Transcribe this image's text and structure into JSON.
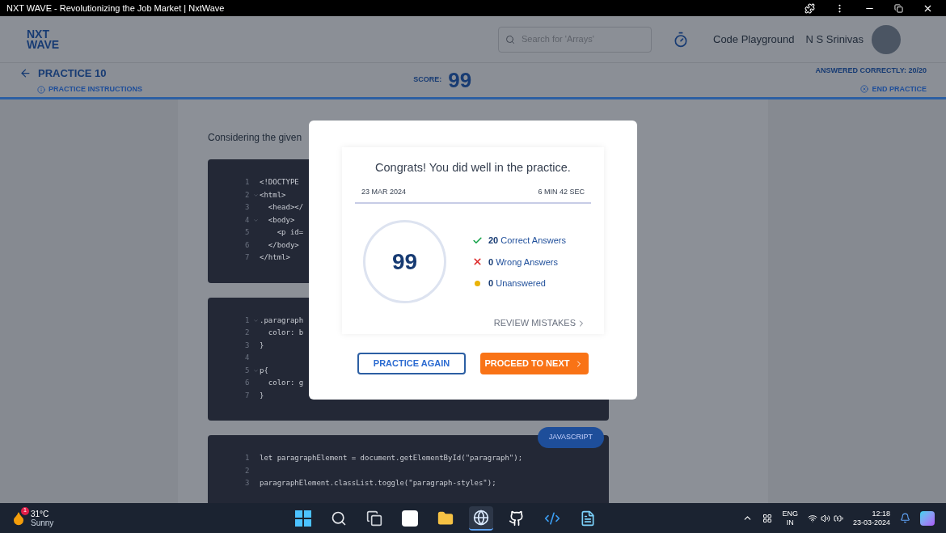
{
  "window": {
    "title": "NXT WAVE - Revolutionizing the Job Market | NxtWave"
  },
  "header": {
    "logo": [
      "NXT",
      "WAVE"
    ],
    "search": {
      "placeholder": "Search for 'Arrays'"
    },
    "link": "Code Playground",
    "user_name": "N S Srinivas"
  },
  "practice_bar": {
    "title": "PRACTICE 10",
    "instructions": "PRACTICE INSTRUCTIONS",
    "score_label": "SCORE:",
    "score": "99",
    "answered": "ANSWERED CORRECTLY: 20/20",
    "end": "END PRACTICE"
  },
  "question": {
    "text": "Considering the given"
  },
  "code_blocks": [
    {
      "lines": [
        {
          "number": "1",
          "fold": false,
          "code": "<!DOCTYPE"
        },
        {
          "number": "2",
          "fold": true,
          "code": "<html>"
        },
        {
          "number": "3",
          "fold": false,
          "code": "  <head></"
        },
        {
          "number": "4",
          "fold": true,
          "code": "  <body>"
        },
        {
          "number": "5",
          "fold": false,
          "code": "    <p id="
        },
        {
          "number": "6",
          "fold": false,
          "code": "  </body>"
        },
        {
          "number": "7",
          "fold": false,
          "code": "</html>"
        }
      ]
    },
    {
      "lines": [
        {
          "number": "1",
          "fold": true,
          "code": ".paragraph"
        },
        {
          "number": "2",
          "fold": false,
          "code": "  color: b"
        },
        {
          "number": "3",
          "fold": false,
          "code": "}"
        },
        {
          "number": "4",
          "fold": false
        },
        {
          "number": "5",
          "fold": true,
          "code": "p{"
        },
        {
          "number": "6",
          "fold": false,
          "code": "  color: g"
        },
        {
          "number": "7",
          "fold": false,
          "code": "}"
        }
      ]
    },
    {
      "language": "JAVASCRIPT",
      "lines": [
        {
          "number": "1",
          "fold": false,
          "code": "let paragraphElement = document.getElementById(\"paragraph\");"
        },
        {
          "number": "2",
          "fold": false
        },
        {
          "number": "3",
          "fold": false,
          "code": "paragraphElement.classList.toggle(\"paragraph-styles\");"
        }
      ]
    }
  ],
  "dialog": {
    "title": "Congrats! You did well in the practice.",
    "date": "23 MAR 2024",
    "duration": "6 MIN 42 SEC",
    "score": "99",
    "stats": [
      {
        "kind": "correct",
        "count": "20",
        "label": "Correct Answers"
      },
      {
        "kind": "wrong",
        "count": "0",
        "label": "Wrong Answers"
      },
      {
        "kind": "unanswered",
        "count": "0",
        "label": "Unanswered"
      }
    ],
    "review": "REVIEW MISTAKES",
    "buttons": [
      {
        "kind": "outline",
        "label": "PRACTICE AGAIN"
      },
      {
        "kind": "primary",
        "label": "PROCEED TO NEXT"
      }
    ]
  },
  "taskbar": {
    "weather": {
      "badge": "1",
      "temp": "31°C",
      "condition": "Sunny"
    },
    "apps": [
      {
        "kind": "start",
        "selected": false
      },
      {
        "kind": "search",
        "selected": false
      },
      {
        "kind": "task-view",
        "selected": false
      },
      {
        "kind": "app-tile",
        "selected": false
      },
      {
        "kind": "folder",
        "selected": false
      },
      {
        "kind": "browser",
        "selected": true
      },
      {
        "kind": "github",
        "selected": false
      },
      {
        "kind": "code-editor",
        "selected": false
      },
      {
        "kind": "notepad",
        "selected": false
      }
    ],
    "language": [
      "ENG",
      "IN"
    ],
    "time": "12:18",
    "date": "23-03-2024"
  }
}
